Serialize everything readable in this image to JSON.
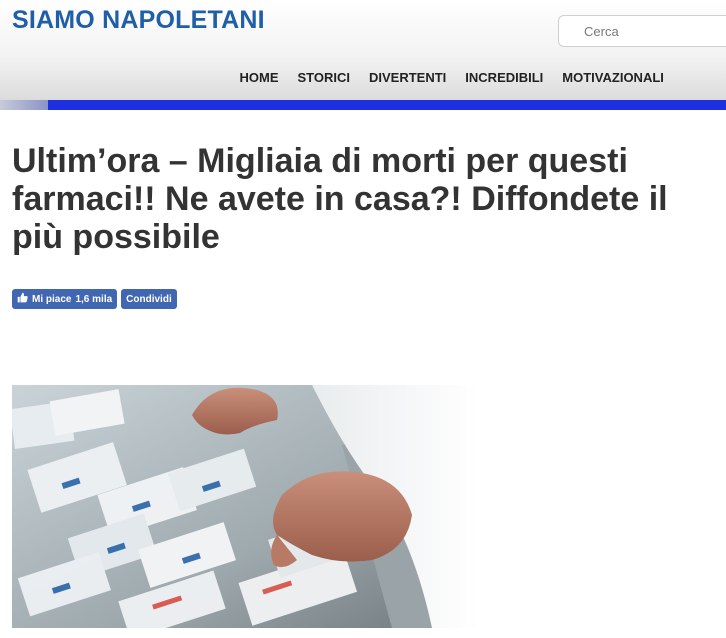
{
  "site": {
    "logo": "SIAMO NAPOLETANI",
    "search_placeholder": "Cerca",
    "accent_color": "#1d2fe0",
    "logo_color": "#1f5fa8"
  },
  "nav": {
    "items": [
      {
        "label": "HOME"
      },
      {
        "label": "STORICI"
      },
      {
        "label": "DIVERTENTI"
      },
      {
        "label": "INCREDIBILI"
      },
      {
        "label": "MOTIVAZIONALI"
      }
    ]
  },
  "article": {
    "title": "Ultim’ora – Migliaia di morti per questi farmaci!! Ne avete in casa?! Diffondete il più possibile"
  },
  "facebook": {
    "like_label": "Mi piace",
    "like_count": "1,6 mila",
    "share_label": "Condividi",
    "button_color": "#4267b2",
    "like_icon": "thumbs-up-icon"
  }
}
